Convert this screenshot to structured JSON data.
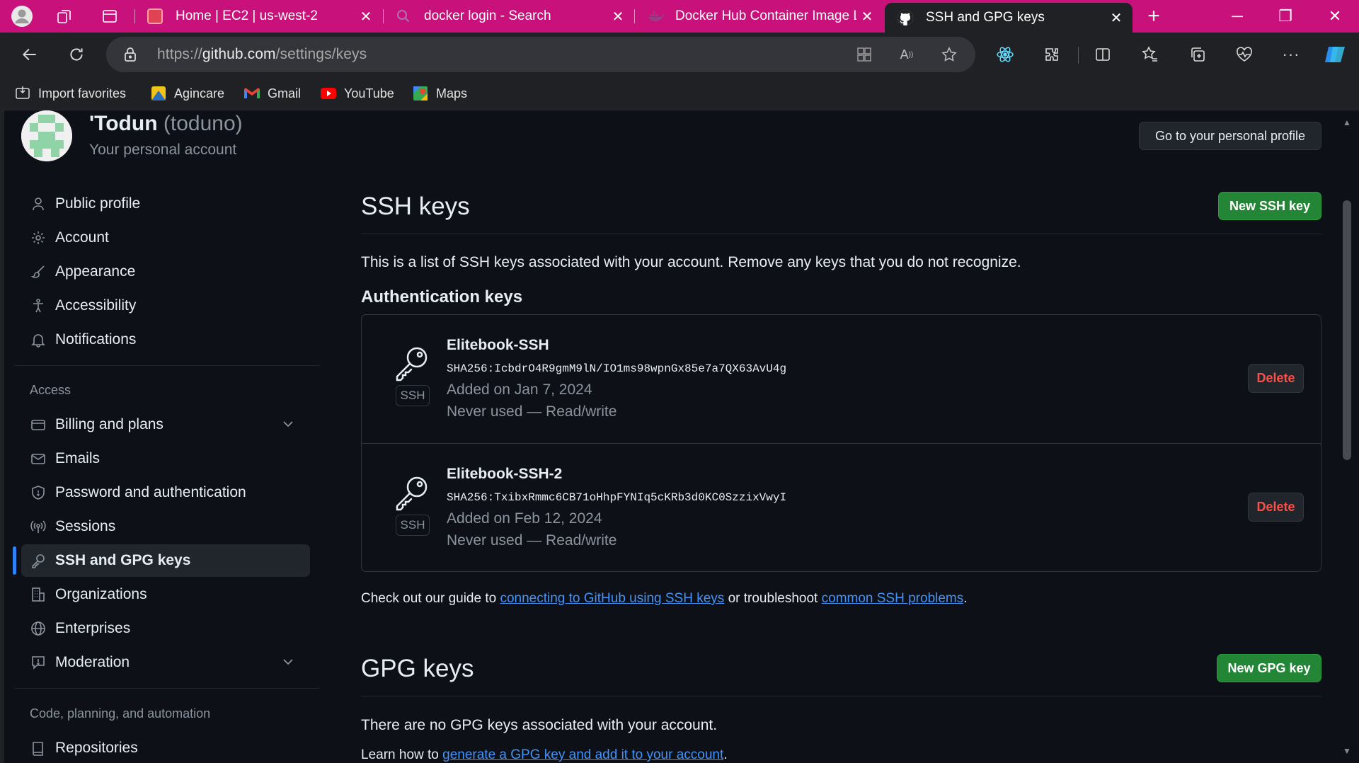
{
  "browser": {
    "tabs": [
      {
        "title": "Home | EC2 | us-west-2",
        "close": "✕"
      },
      {
        "title": "docker login - Search",
        "close": "✕"
      },
      {
        "title": "Docker Hub Container Image Li",
        "close": "✕"
      },
      {
        "title": "SSH and GPG keys",
        "close": "✕"
      }
    ],
    "new_tab": "+",
    "window": {
      "minimize": "─",
      "restore": "❐",
      "close": "✕"
    },
    "url_prefix": "https://",
    "url_host": "github.com",
    "url_path": "/settings/keys",
    "bookmarks": [
      {
        "label": "Import favorites",
        "icon": "import-icon"
      },
      {
        "label": "Agincare",
        "icon": "agincare-icon"
      },
      {
        "label": "Gmail",
        "icon": "gmail-icon"
      },
      {
        "label": "YouTube",
        "icon": "youtube-icon"
      },
      {
        "label": "Maps",
        "icon": "maps-icon"
      }
    ],
    "colors": {
      "tabbar": "#c8117a",
      "chrome": "#202124"
    }
  },
  "account": {
    "display_name": "'Todun",
    "handle": "(toduno)",
    "subtitle": "Your personal account",
    "profile_button": "Go to your personal profile"
  },
  "sidebar": {
    "items": [
      {
        "label": "Public profile",
        "icon": "person-icon"
      },
      {
        "label": "Account",
        "icon": "gear-icon"
      },
      {
        "label": "Appearance",
        "icon": "paintbrush-icon"
      },
      {
        "label": "Accessibility",
        "icon": "accessibility-icon"
      },
      {
        "label": "Notifications",
        "icon": "bell-icon"
      }
    ],
    "access_heading": "Access",
    "access_items": [
      {
        "label": "Billing and plans",
        "icon": "credit-card-icon",
        "expandable": true
      },
      {
        "label": "Emails",
        "icon": "mail-icon"
      },
      {
        "label": "Password and authentication",
        "icon": "shield-icon"
      },
      {
        "label": "Sessions",
        "icon": "broadcast-icon"
      },
      {
        "label": "SSH and GPG keys",
        "icon": "key-icon",
        "active": true
      },
      {
        "label": "Organizations",
        "icon": "organization-icon"
      },
      {
        "label": "Enterprises",
        "icon": "globe-icon"
      },
      {
        "label": "Moderation",
        "icon": "report-icon",
        "expandable": true
      }
    ],
    "code_heading": "Code, planning, and automation",
    "code_items": [
      {
        "label": "Repositories",
        "icon": "repo-icon"
      }
    ]
  },
  "ssh": {
    "heading": "SSH keys",
    "new_button": "New SSH key",
    "intro": "This is a list of SSH keys associated with your account. Remove any keys that you do not recognize.",
    "auth_heading": "Authentication keys",
    "keys": [
      {
        "title": "Elitebook-SSH",
        "fingerprint": "SHA256:IcbdrO4R9gmM9lN/IO1ms98wpnGx85e7a7QX63AvU4g",
        "added": "Added on Jan 7, 2024",
        "usage": "Never used — Read/write",
        "badge": "SSH",
        "delete": "Delete"
      },
      {
        "title": "Elitebook-SSH-2",
        "fingerprint": "SHA256:TxibxRmmc6CB71oHhpFYNIq5cKRb3d0KC0SzzixVwyI",
        "added": "Added on Feb 12, 2024",
        "usage": "Never used — Read/write",
        "badge": "SSH",
        "delete": "Delete"
      }
    ],
    "guide_prefix": "Check out our guide to ",
    "guide_link": "connecting to GitHub using SSH keys",
    "guide_mid": " or troubleshoot ",
    "guide_link2": "common SSH problems",
    "guide_suffix": "."
  },
  "gpg": {
    "heading": "GPG keys",
    "new_button": "New GPG key",
    "empty": "There are no GPG keys associated with your account.",
    "learn_prefix": "Learn how to ",
    "learn_link": "generate a GPG key and add it to your account",
    "learn_suffix": "."
  }
}
